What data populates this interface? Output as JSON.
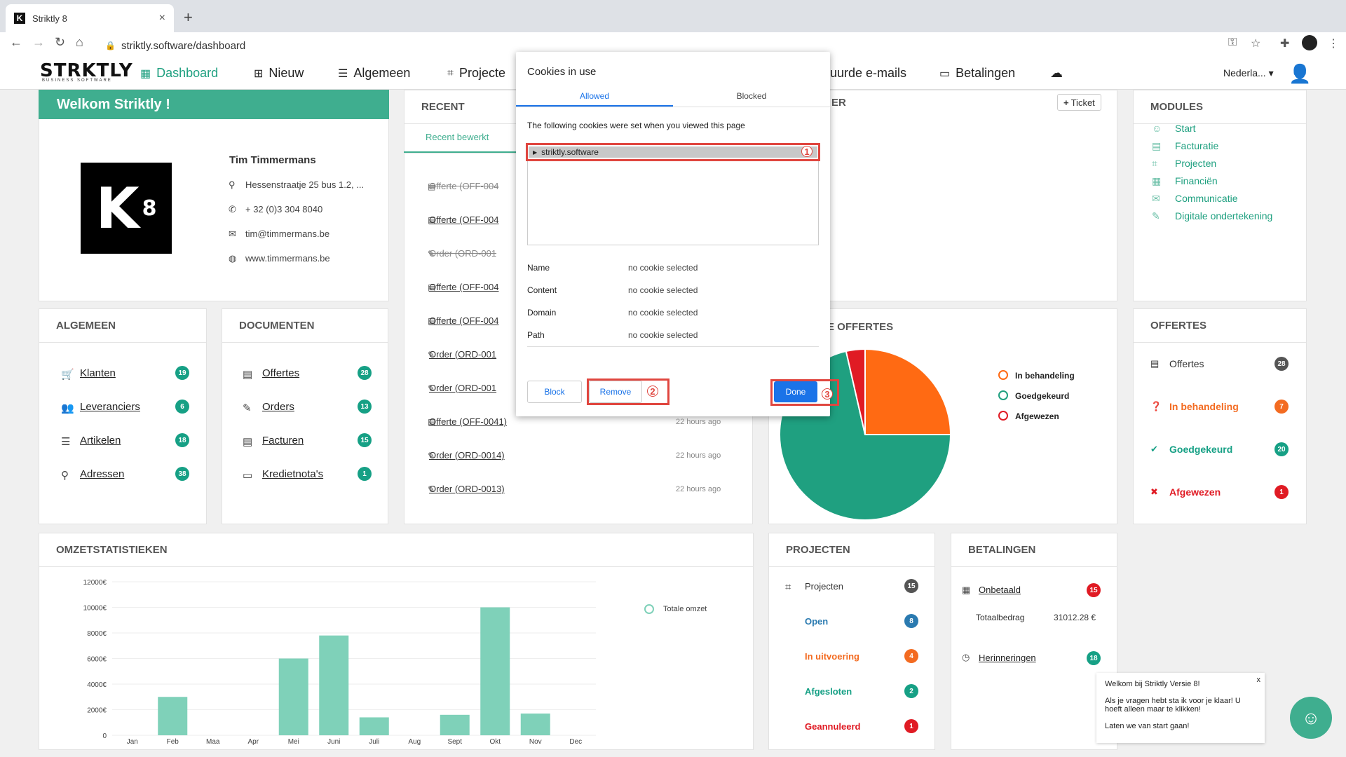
{
  "browser": {
    "tab_title": "Striktly 8",
    "url": "striktly.software/dashboard"
  },
  "app": {
    "logo": "STRKTLY",
    "logo_sub": "BUSINESS SOFTWARE",
    "menu": [
      "Dashboard",
      "Nieuw",
      "Algemeen",
      "Projecte",
      "uurde e-mails",
      "Betalingen"
    ],
    "language": "Nederla..."
  },
  "welcome": {
    "title": "Welkom Striktly !",
    "name": "Tim Timmermans",
    "address": "Hessenstraatje 25 bus 1.2, ...",
    "phone": "+ 32 (0)3 304 8040",
    "email": "tim@timmermans.be",
    "website": "www.timmermans.be"
  },
  "recent": {
    "title": "RECENT",
    "tab": "Recent bewerkt",
    "items": [
      {
        "label": "Offerte (OFF-004",
        "time": ""
      },
      {
        "label": "Offerte (OFF-004",
        "time": ""
      },
      {
        "label": "Order (ORD-001",
        "time": ""
      },
      {
        "label": "Offerte (OFF-004",
        "time": ""
      },
      {
        "label": "Offerte (OFF-004",
        "time": ""
      },
      {
        "label": "Order (ORD-001",
        "time": ""
      },
      {
        "label": "Order (ORD-001",
        "time": ""
      },
      {
        "label": "Offerte (OFF-0041)",
        "time": "22 hours ago"
      },
      {
        "label": "Order (ORD-0014)",
        "time": "22 hours ago"
      },
      {
        "label": "Order (ORD-0013)",
        "time": "22 hours ago"
      }
    ]
  },
  "ticket_card": {
    "title_tail": "ER",
    "ticket_button": "Ticket"
  },
  "modules": {
    "title": "MODULES",
    "items": [
      "Start",
      "Facturatie",
      "Projecten",
      "Financiën",
      "Communicatie",
      "Digitale ondertekening"
    ]
  },
  "algemeen": {
    "title": "ALGEMEEN",
    "items": [
      {
        "label": "Klanten",
        "count": "19"
      },
      {
        "label": "Leveranciers",
        "count": "6"
      },
      {
        "label": "Artikelen",
        "count": "18"
      },
      {
        "label": "Adressen",
        "count": "38"
      }
    ]
  },
  "documenten": {
    "title": "DOCUMENTEN",
    "items": [
      {
        "label": "Offertes",
        "count": "28"
      },
      {
        "label": "Orders",
        "count": "13"
      },
      {
        "label": "Facturen",
        "count": "15"
      },
      {
        "label": "Kredietnota's",
        "count": "1"
      }
    ]
  },
  "offertes_chart_card": {
    "title_tail": "E OFFERTES",
    "legend": [
      "In behandeling",
      "Goedgekeurd",
      "Afgewezen"
    ]
  },
  "offertes": {
    "title": "OFFERTES",
    "items": [
      {
        "label": "Offertes",
        "count": "28",
        "color": "#333333"
      },
      {
        "label": "In behandeling",
        "count": "7",
        "color": "#f36b21"
      },
      {
        "label": "Goedgekeurd",
        "count": "20",
        "color": "#16a085"
      },
      {
        "label": "Afgewezen",
        "count": "1",
        "color": "#e01b24"
      }
    ]
  },
  "omzet": {
    "title": "OMZETSTATISTIEKEN",
    "legend": "Totale omzet"
  },
  "projecten": {
    "title": "PROJECTEN",
    "items": [
      {
        "label": "Projecten",
        "count": "15"
      },
      {
        "label": "Open",
        "count": "8"
      },
      {
        "label": "In uitvoering",
        "count": "4"
      },
      {
        "label": "Afgesloten",
        "count": "2"
      },
      {
        "label": "Geannuleerd",
        "count": "1"
      }
    ]
  },
  "betalingen": {
    "title": "BETALINGEN",
    "unpaid_label": "Onbetaald",
    "unpaid_count": "15",
    "total_label": "Totaalbedrag",
    "total_value": "31012.28 €",
    "reminders_label": "Herinneringen",
    "reminders_count": "18"
  },
  "popup": {
    "title": "Cookies in use",
    "tab_allowed": "Allowed",
    "tab_blocked": "Blocked",
    "description": "The following cookies were set when you viewed this page",
    "cookie": "striktly.software",
    "details": [
      {
        "label": "Name",
        "value": "no cookie selected"
      },
      {
        "label": "Content",
        "value": "no cookie selected"
      },
      {
        "label": "Domain",
        "value": "no cookie selected"
      },
      {
        "label": "Path",
        "value": "no cookie selected"
      }
    ],
    "block_button": "Block",
    "remove_button": "Remove",
    "done_button": "Done",
    "steps": [
      "1",
      "2",
      "3"
    ]
  },
  "chat": {
    "close": "x",
    "line1": "Welkom bij Striktly Versie 8!",
    "line2": "Als je vragen hebt sta ik voor je klaar! U hoeft alleen maar te klikken!",
    "line3": "Laten we van start gaan!"
  },
  "chart_data": [
    {
      "type": "bar",
      "title": "",
      "categories": [
        "Jan",
        "Feb",
        "Maa",
        "Apr",
        "Mei",
        "Juni",
        "Juli",
        "Aug",
        "Sept",
        "Okt",
        "Nov",
        "Dec"
      ],
      "series": [
        {
          "name": "Totale omzet",
          "values": [
            0,
            3000,
            0,
            0,
            6000,
            7800,
            1400,
            0,
            1600,
            10000,
            1700,
            0
          ]
        }
      ],
      "yticks": [
        "12000€",
        "10000€",
        "8000€",
        "6000€",
        "4000€",
        "2000€",
        "0"
      ],
      "ylim": [
        0,
        12000
      ],
      "color": "#7fd1b9"
    },
    {
      "type": "pie",
      "title": "",
      "categories": [
        "In behandeling",
        "Goedgekeurd",
        "Afgewezen"
      ],
      "values": [
        7,
        20,
        1
      ],
      "colors": [
        "#ff6a13",
        "#1fa080",
        "#e01b24"
      ]
    }
  ]
}
